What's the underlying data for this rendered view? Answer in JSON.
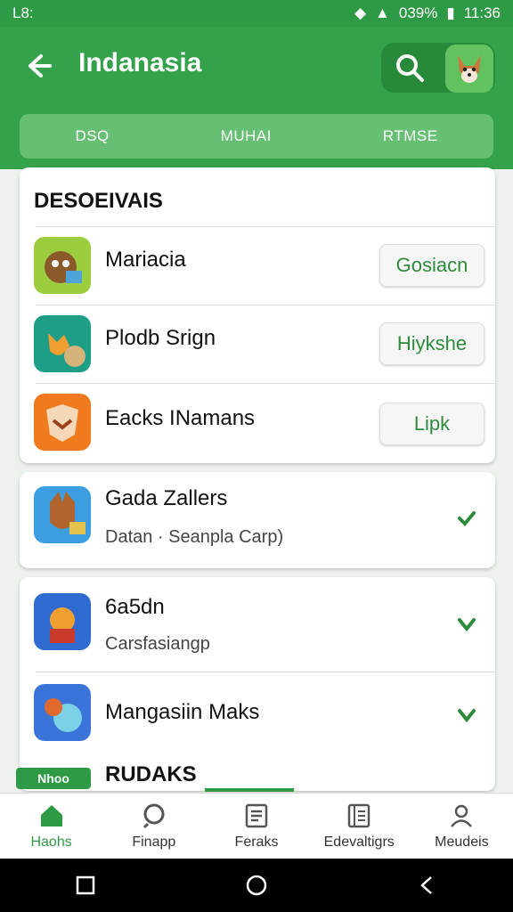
{
  "status_bar": {
    "left": "L8:",
    "battery": "039%",
    "time": "11:36"
  },
  "app_bar": {
    "title": "Indanasia"
  },
  "tabs": [
    "DSQ",
    "MUHAI",
    "RTMSE"
  ],
  "section": {
    "title": "DESOEIVAIS"
  },
  "apps_main": [
    {
      "name": "Mariacia",
      "button": "Gosiacn"
    },
    {
      "name": "Plodb Srign",
      "button": "Hiykshe"
    },
    {
      "name": "Eacks INamans",
      "button": "Lipk"
    }
  ],
  "app_single": {
    "name": "Gada Zallers",
    "subtitle": "Datan · Seanpla Carp)"
  },
  "apps_more": [
    {
      "name": "6a5dn",
      "subtitle": "Carsfasiangp"
    },
    {
      "name": "Mangasiin Maks"
    }
  ],
  "footer_section": {
    "badge": "Nhoo",
    "title": "RUDAKS"
  },
  "bottom_nav": [
    "Haohs",
    "Finapp",
    "Feraks",
    "Edevaltigrs",
    "Meudeis"
  ]
}
